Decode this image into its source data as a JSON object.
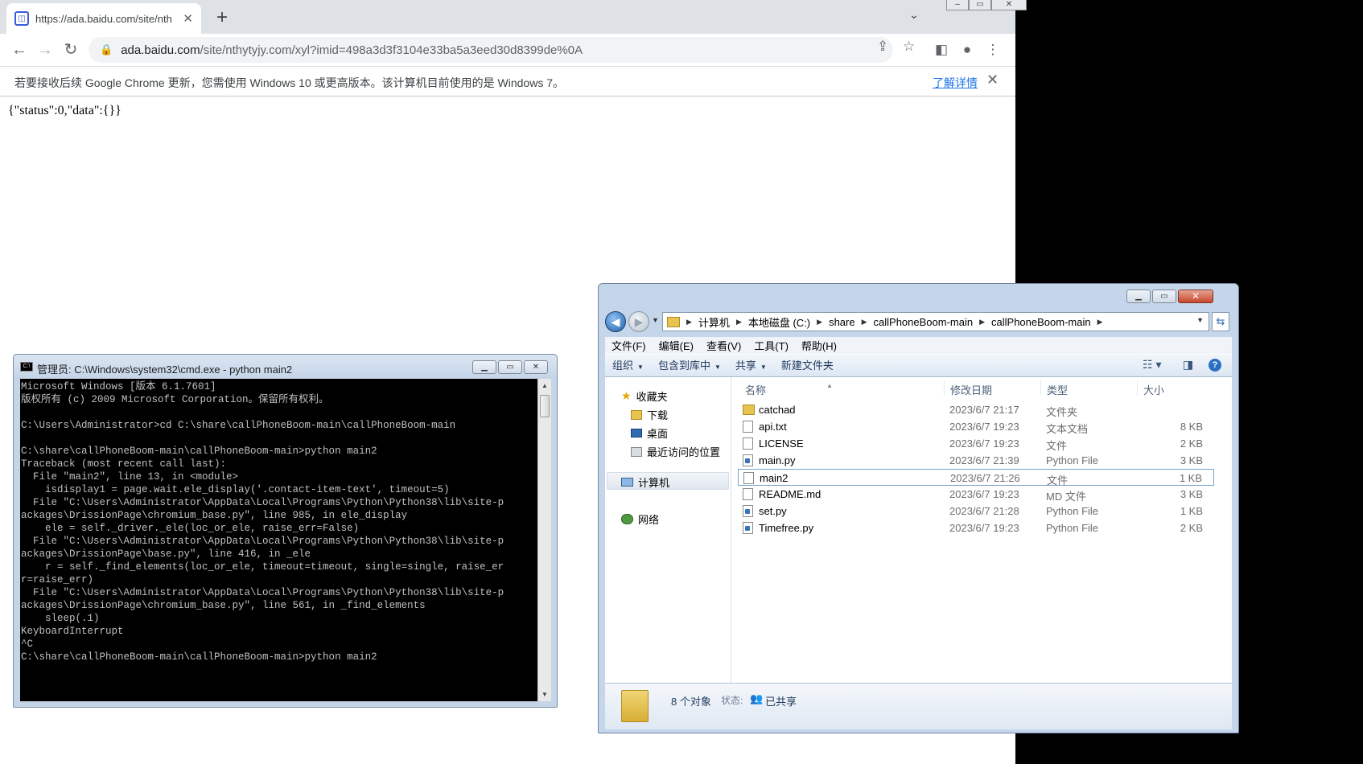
{
  "chrome": {
    "tab_title": "https://ada.baidu.com/site/nth",
    "new_tab": "+",
    "url_host": "ada.baidu.com",
    "url_path": "/site/nthytyjy.com/xyl?imid=498a3d3f3104e33ba5a3eed30d8399de%0A",
    "infobar_message": "若要接收后续 Google Chrome 更新，您需使用 Windows 10 或更高版本。该计算机目前使用的是 Windows 7。",
    "infobar_link": "了解详情",
    "page_body": "{\"status\":0,\"data\":{}}"
  },
  "cmd": {
    "title": "管理员: C:\\Windows\\system32\\cmd.exe - python  main2",
    "lines": [
      "Microsoft Windows [版本 6.1.7601]",
      "版权所有 (c) 2009 Microsoft Corporation。保留所有权利。",
      "",
      "C:\\Users\\Administrator>cd C:\\share\\callPhoneBoom-main\\callPhoneBoom-main",
      "",
      "C:\\share\\callPhoneBoom-main\\callPhoneBoom-main>python main2",
      "Traceback (most recent call last):",
      "  File \"main2\", line 13, in <module>",
      "    isdisplay1 = page.wait.ele_display('.contact-item-text', timeout=5)",
      "  File \"C:\\Users\\Administrator\\AppData\\Local\\Programs\\Python\\Python38\\lib\\site-p",
      "ackages\\DrissionPage\\chromium_base.py\", line 985, in ele_display",
      "    ele = self._driver._ele(loc_or_ele, raise_err=False)",
      "  File \"C:\\Users\\Administrator\\AppData\\Local\\Programs\\Python\\Python38\\lib\\site-p",
      "ackages\\DrissionPage\\base.py\", line 416, in _ele",
      "    r = self._find_elements(loc_or_ele, timeout=timeout, single=single, raise_er",
      "r=raise_err)",
      "  File \"C:\\Users\\Administrator\\AppData\\Local\\Programs\\Python\\Python38\\lib\\site-p",
      "ackages\\DrissionPage\\chromium_base.py\", line 561, in _find_elements",
      "    sleep(.1)",
      "KeyboardInterrupt",
      "^C",
      "C:\\share\\callPhoneBoom-main\\callPhoneBoom-main>python main2"
    ]
  },
  "explorer": {
    "breadcrumbs": [
      "计算机",
      "本地磁盘 (C:)",
      "share",
      "callPhoneBoom-main",
      "callPhoneBoom-main"
    ],
    "menu": [
      "文件(F)",
      "编辑(E)",
      "查看(V)",
      "工具(T)",
      "帮助(H)"
    ],
    "commands": {
      "organize": "组织",
      "include": "包含到库中",
      "share": "共享",
      "new_folder": "新建文件夹"
    },
    "nav": {
      "favorites": "收藏夹",
      "downloads": "下载",
      "desktop": "桌面",
      "recent": "最近访问的位置",
      "computer": "计算机",
      "network": "网络"
    },
    "columns": {
      "name": "名称",
      "modified": "修改日期",
      "type": "类型",
      "size": "大小"
    },
    "files": [
      {
        "name": "catchad",
        "modified": "2023/6/7 21:17",
        "type": "文件夹",
        "size": "",
        "icon": "folder"
      },
      {
        "name": "api.txt",
        "modified": "2023/6/7 19:23",
        "type": "文本文档",
        "size": "8 KB",
        "icon": "doc"
      },
      {
        "name": "LICENSE",
        "modified": "2023/6/7 19:23",
        "type": "文件",
        "size": "2 KB",
        "icon": "doc"
      },
      {
        "name": "main.py",
        "modified": "2023/6/7 21:39",
        "type": "Python File",
        "size": "3 KB",
        "icon": "py"
      },
      {
        "name": "main2",
        "modified": "2023/6/7 21:26",
        "type": "文件",
        "size": "1 KB",
        "icon": "doc"
      },
      {
        "name": "README.md",
        "modified": "2023/6/7 19:23",
        "type": "MD 文件",
        "size": "3 KB",
        "icon": "doc"
      },
      {
        "name": "set.py",
        "modified": "2023/6/7 21:28",
        "type": "Python File",
        "size": "1 KB",
        "icon": "py"
      },
      {
        "name": "Timefree.py",
        "modified": "2023/6/7 19:23",
        "type": "Python File",
        "size": "2 KB",
        "icon": "py"
      }
    ],
    "status": {
      "count": "8 个对象",
      "state_label": "状态:",
      "state_value": "已共享"
    }
  }
}
